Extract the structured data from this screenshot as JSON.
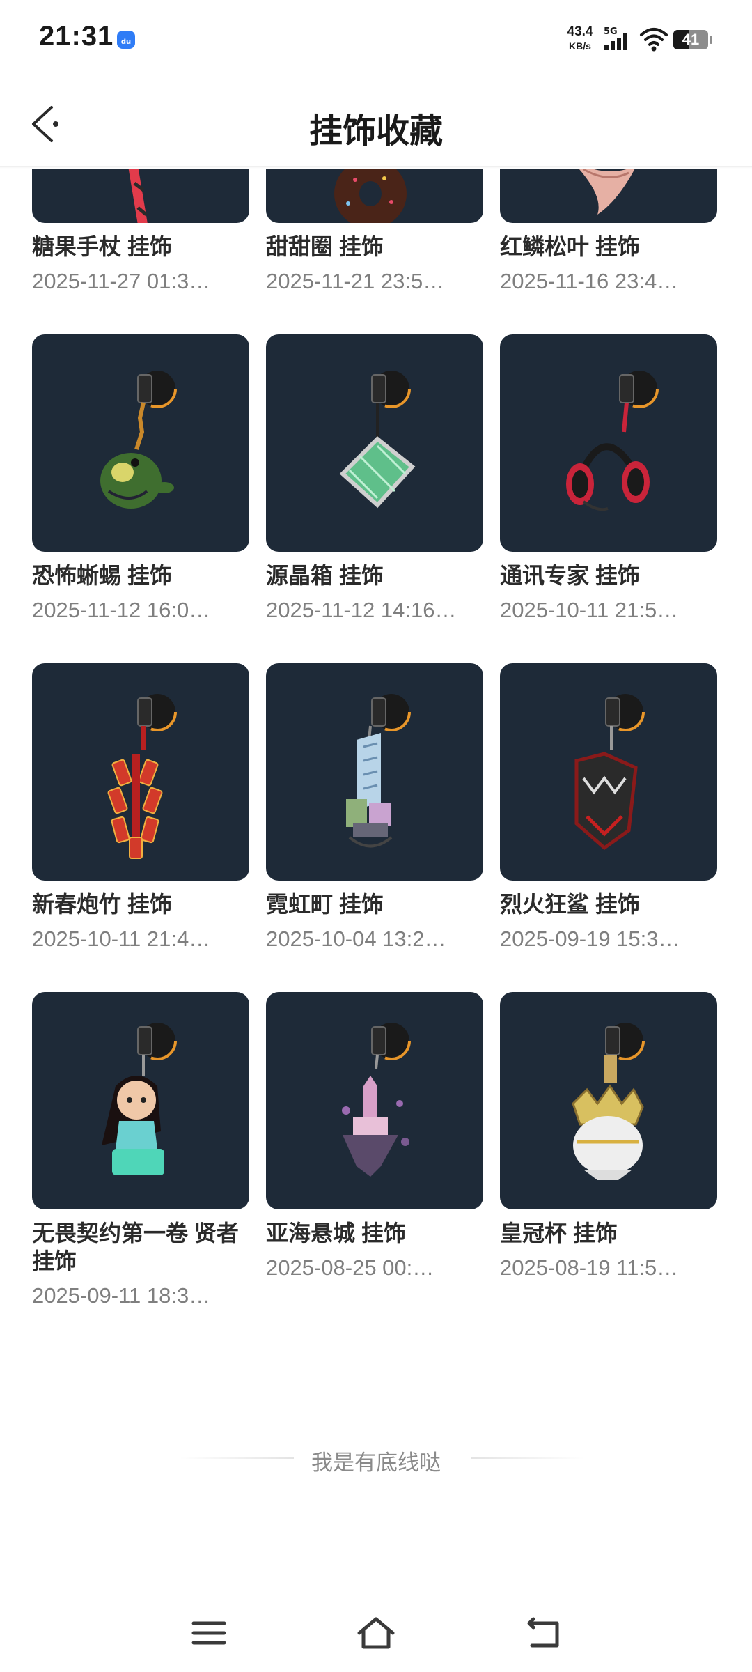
{
  "status_bar": {
    "time": "21:31",
    "net_speed_value": "43.4",
    "net_speed_unit": "KB/s",
    "network_type": "5G",
    "battery_level": "41"
  },
  "header": {
    "title": "挂饰收藏"
  },
  "items": [
    {
      "name": "糖果手杖 挂饰",
      "date": "2025-11-27 01:3…",
      "icon": "candy-cane-charm"
    },
    {
      "name": "甜甜圈 挂饰",
      "date": "2025-11-21 23:5…",
      "icon": "donut-charm"
    },
    {
      "name": "红鳞松叶 挂饰",
      "date": "2025-11-16 23:4…",
      "icon": "red-scale-pine-charm"
    },
    {
      "name": "恐怖蜥蜴 挂饰",
      "date": "2025-11-12 16:0…",
      "icon": "lizard-charm"
    },
    {
      "name": "源晶箱 挂饰",
      "date": "2025-11-12 14:16…",
      "icon": "crystal-box-charm"
    },
    {
      "name": "通讯专家 挂饰",
      "date": "2025-10-11 21:5…",
      "icon": "headset-charm"
    },
    {
      "name": "新春炮竹 挂饰",
      "date": "2025-10-11 21:4…",
      "icon": "firecracker-charm"
    },
    {
      "name": "霓虹町 挂饰",
      "date": "2025-10-04 13:2…",
      "icon": "neon-town-charm"
    },
    {
      "name": "烈火狂鲨 挂饰",
      "date": "2025-09-19 15:3…",
      "icon": "fire-shark-charm"
    },
    {
      "name": "无畏契约第一卷 贤者 挂饰",
      "date": "2025-09-11 18:3…",
      "icon": "sage-charm"
    },
    {
      "name": "亚海悬城 挂饰",
      "date": "2025-08-25 00:…",
      "icon": "floating-city-charm"
    },
    {
      "name": "皇冠杯 挂饰",
      "date": "2025-08-19 11:5…",
      "icon": "crown-cup-charm"
    }
  ],
  "footer": {
    "end_text": "我是有底线哒"
  },
  "colors": {
    "card_bg": "#1e2a38",
    "ring_orange": "#e8962a"
  }
}
